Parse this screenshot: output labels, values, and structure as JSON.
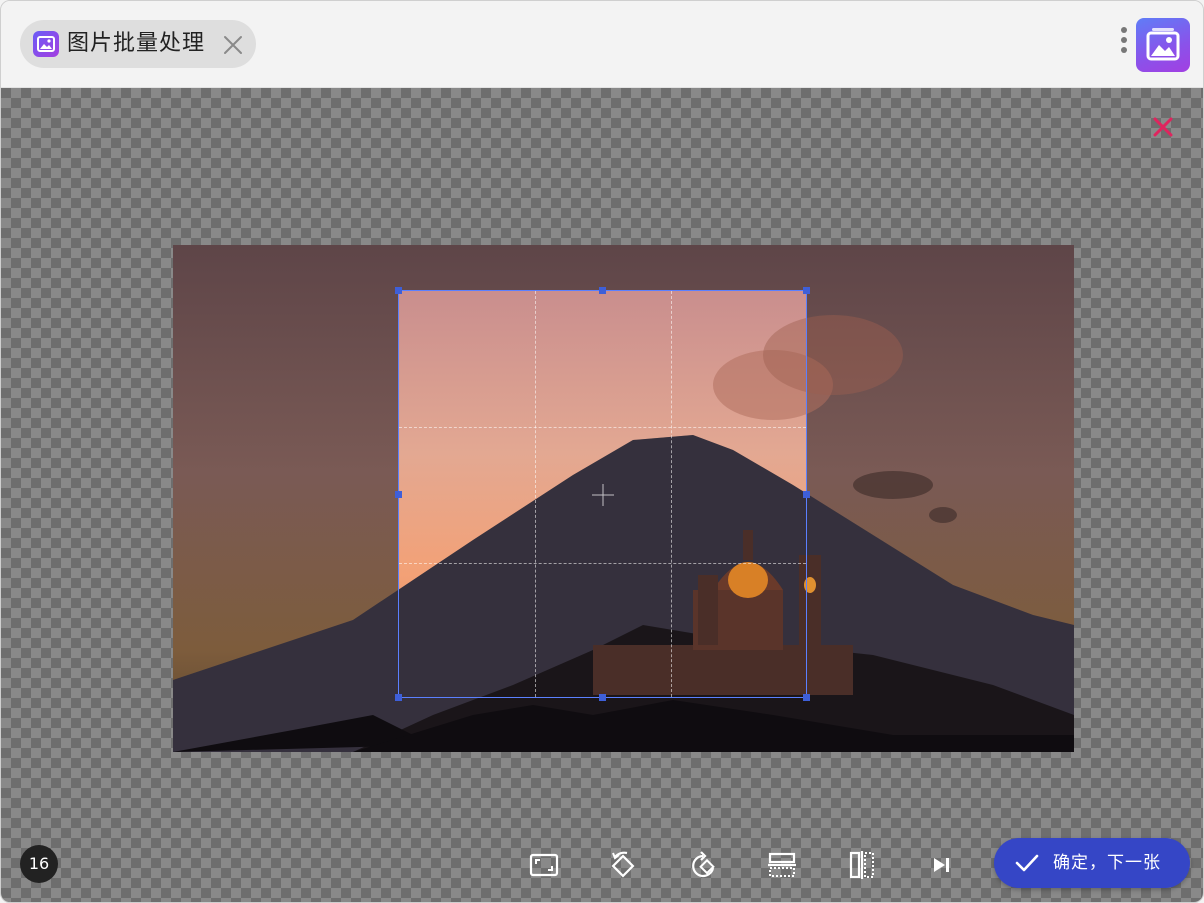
{
  "tab": {
    "title": "图片批量处理",
    "icon": "image-icon",
    "close_icon": "close-icon"
  },
  "header": {
    "menu_icon": "more-vertical-icon",
    "app_icon": "gallery-app-icon"
  },
  "viewer": {
    "close_icon": "close-icon",
    "close_color": "#e0245e",
    "image_alt": "volcano-with-church-at-sunset"
  },
  "counter": {
    "value": "16"
  },
  "toolbar": {
    "tools": [
      {
        "name": "aspect-ratio-icon"
      },
      {
        "name": "rotate-left-icon"
      },
      {
        "name": "rotate-right-icon"
      },
      {
        "name": "flip-vertical-icon"
      },
      {
        "name": "flip-horizontal-icon"
      },
      {
        "name": "skip-next-icon"
      }
    ],
    "confirm_label": "确定，下一张",
    "confirm_color": "#3546c6"
  }
}
